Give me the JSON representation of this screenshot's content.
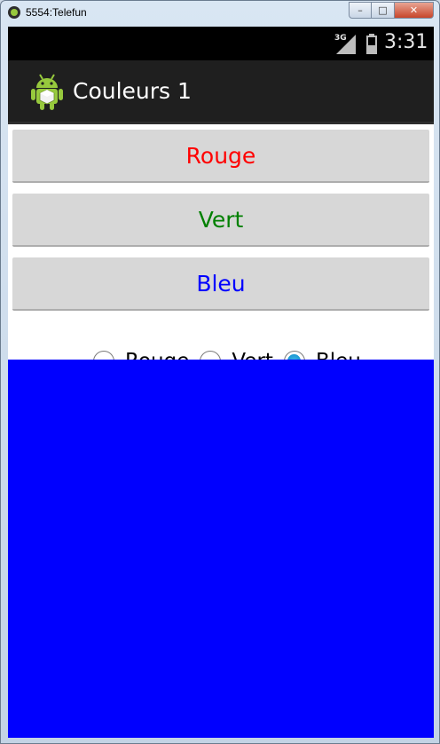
{
  "window": {
    "title": "5554:Telefun",
    "buttons": {
      "minimize_icon": "minimize-icon",
      "maximize_icon": "maximize-icon",
      "close_icon": "close-icon"
    }
  },
  "statusbar": {
    "network": "3G",
    "time": "3:31"
  },
  "actionbar": {
    "title": "Couleurs 1",
    "icon": "android-icon"
  },
  "buttons": [
    {
      "label": "Rouge",
      "color": "#ff0000"
    },
    {
      "label": "Vert",
      "color": "#008000"
    },
    {
      "label": "Bleu",
      "color": "#0000ff"
    }
  ],
  "radio_group": {
    "options": [
      {
        "label": "Rouge",
        "checked": false
      },
      {
        "label": "Vert",
        "checked": false
      },
      {
        "label": "Bleu",
        "checked": true
      }
    ],
    "accent": "#1a9bd7"
  },
  "color_panel": {
    "color": "#0000ff"
  }
}
